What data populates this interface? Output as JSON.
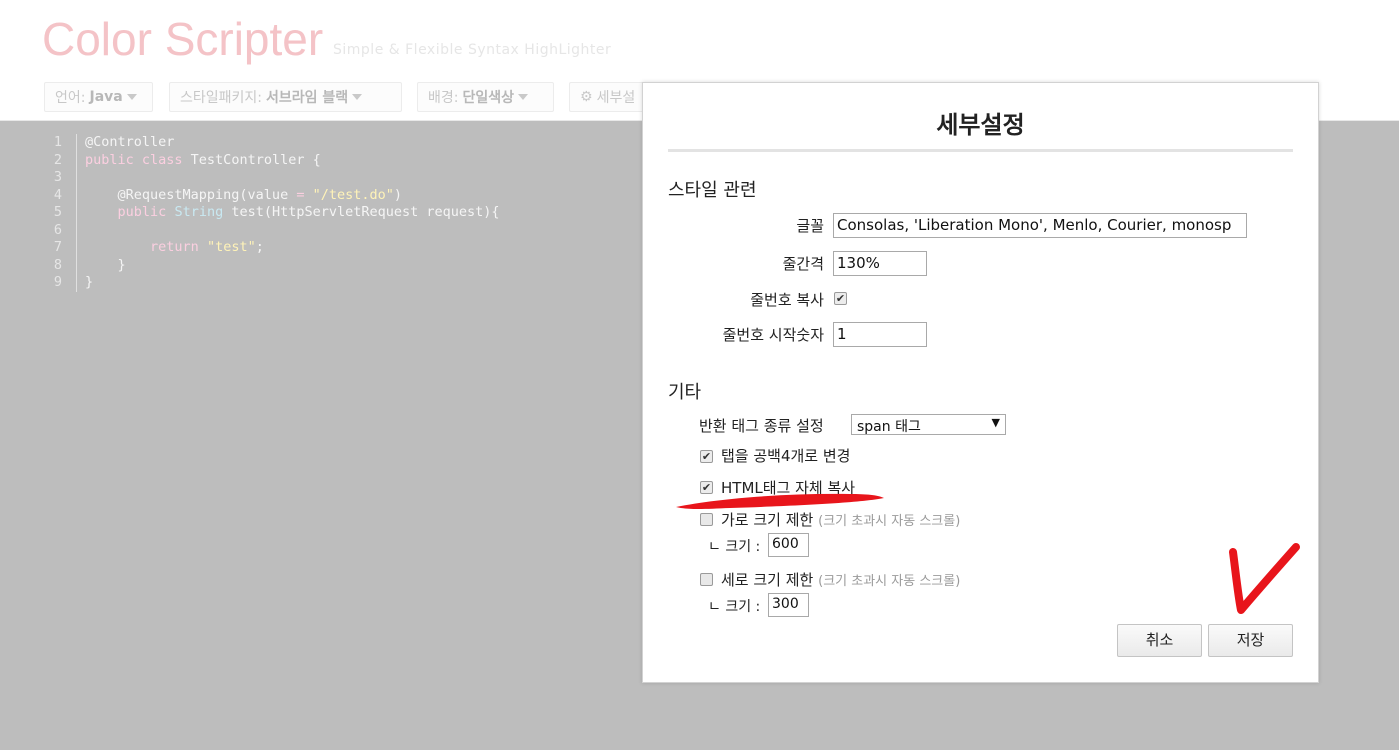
{
  "header": {
    "logo": "Color Scripter",
    "tagline": "Simple & Flexible Syntax HighLighter"
  },
  "toolbar": {
    "language_label": "언어:",
    "language_value": "Java",
    "style_label": "스타일패키지:",
    "style_value": "서브라임 블랙",
    "background_label": "배경:",
    "background_value": "단일색상",
    "settings_label": "세부설"
  },
  "code": {
    "line_numbers": [
      "1",
      "2",
      "3",
      "4",
      "5",
      "6",
      "7",
      "8",
      "9"
    ]
  },
  "dialog": {
    "title": "세부설정",
    "style_section": "스타일 관련",
    "font_label": "글꼴",
    "font_value": "Consolas, 'Liberation Mono', Menlo, Courier, monosp",
    "line_height_label": "줄간격",
    "line_height_value": "130%",
    "copy_line_numbers_label": "줄번호 복사",
    "copy_line_numbers_checked": true,
    "line_start_label": "줄번호 시작숫자",
    "line_start_value": "1",
    "other_section": "기타",
    "return_tag_label": "반환 태그 종류 설정",
    "return_tag_value": "span 태그",
    "tab_to_spaces_label": "탭을 공백4개로 변경",
    "tab_to_spaces_checked": true,
    "copy_html_label": "HTML태그 자체 복사",
    "copy_html_checked": true,
    "width_limit_label": "가로 크기 제한",
    "width_limit_hint": "(크기 초과시 자동 스크롤)",
    "width_limit_checked": false,
    "width_size_label": "ㄴ 크기 :",
    "width_size_value": "600",
    "height_limit_label": "세로 크기 제한",
    "height_limit_hint": "(크기 초과시 자동 스크롤)",
    "height_limit_checked": false,
    "height_size_label": "ㄴ 크기 :",
    "height_size_value": "300",
    "cancel_label": "취소",
    "save_label": "저장"
  },
  "colors": {
    "annotation": "#e8151b",
    "background": "#bdbdbd",
    "logo": "#f4c3c7"
  }
}
